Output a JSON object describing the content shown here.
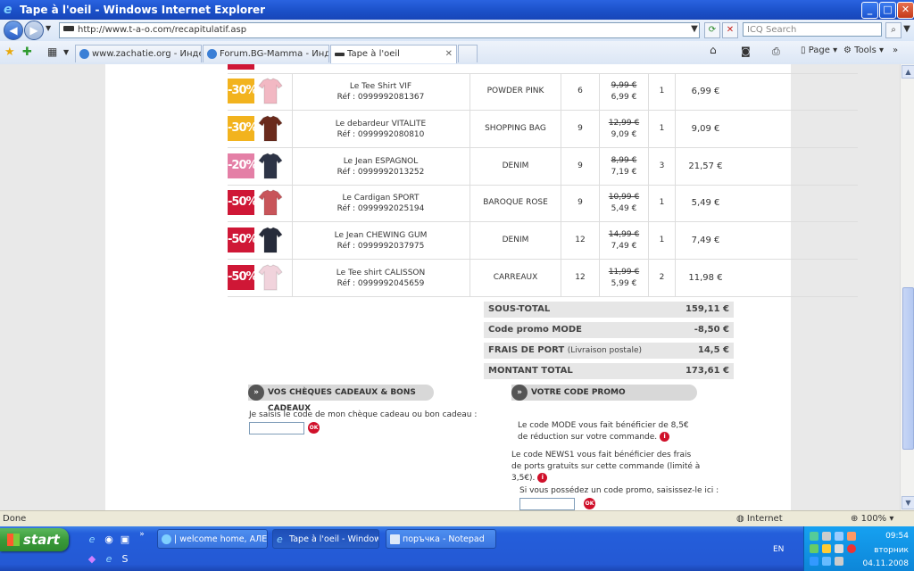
{
  "window": {
    "title": "Tape à l'oeil - Windows Internet Explorer",
    "min": "_",
    "max": "□",
    "close": "✕"
  },
  "address": {
    "url": "http://www.t-a-o.com/recapitulatif.asp",
    "search_placeholder": "ICQ Search"
  },
  "tabs": [
    {
      "label": "www.zachatie.org - Индекс"
    },
    {
      "label": "Forum.BG-Mamma - Индекс"
    },
    {
      "label": "Tape à l'oeil"
    }
  ],
  "commands": {
    "page": "Page",
    "tools": "Tools"
  },
  "items": [
    {
      "discount": "-30%",
      "badge_color": "#f2b31e",
      "img_color": "#f2b8c3",
      "name": "Le Tee Shirt VIF",
      "ref": "Réf : 0999992081367",
      "color": "POWDER PINK",
      "size": "6",
      "old_price": "9,99 €",
      "new_price": "6,99 €",
      "qty": "1",
      "total": "6,99 €"
    },
    {
      "discount": "-30%",
      "badge_color": "#f2b31e",
      "img_color": "#6a2a1c",
      "name": "Le debardeur VITALITE",
      "ref": "Réf : 0999992080810",
      "color": "SHOPPING BAG",
      "size": "9",
      "old_price": "12,99 €",
      "new_price": "9,09 €",
      "qty": "1",
      "total": "9,09 €"
    },
    {
      "discount": "-20%",
      "badge_color": "#e47fa6",
      "img_color": "#2d3446",
      "name": "Le Jean ESPAGNOL",
      "ref": "Réf : 0999992013252",
      "color": "DENIM",
      "size": "9",
      "old_price": "8,99 €",
      "new_price": "7,19 €",
      "qty": "3",
      "total": "21,57 €"
    },
    {
      "discount": "-50%",
      "badge_color": "#cf1736",
      "img_color": "#c8555a",
      "name": "Le Cardigan SPORT",
      "ref": "Réf : 0999992025194",
      "color": "BAROQUE ROSE",
      "size": "9",
      "old_price": "10,99 €",
      "new_price": "5,49 €",
      "qty": "1",
      "total": "5,49 €"
    },
    {
      "discount": "-50%",
      "badge_color": "#cf1736",
      "img_color": "#262b3a",
      "name": "Le Jean CHEWING GUM",
      "ref": "Réf : 0999992037975",
      "color": "DENIM",
      "size": "12",
      "old_price": "14,99 €",
      "new_price": "7,49 €",
      "qty": "1",
      "total": "7,49 €"
    },
    {
      "discount": "-50%",
      "badge_color": "#cf1736",
      "img_color": "#f1d3dc",
      "name": "Le Tee shirt CALISSON",
      "ref": "Réf : 0999992045659",
      "color": "CARREAUX",
      "size": "12",
      "old_price": "11,99 €",
      "new_price": "5,99 €",
      "qty": "2",
      "total": "11,98 €"
    }
  ],
  "summary": {
    "subtotal_label": "SOUS-TOTAL",
    "subtotal_value": "159,11 €",
    "promo_label": "Code promo MODE",
    "promo_value": "-8,50 €",
    "shipping_label": "FRAIS DE PORT",
    "shipping_note": "(Livraison postale)",
    "shipping_value": "14,5 €",
    "total_label": "MONTANT TOTAL",
    "total_value": "173,61 €"
  },
  "gift": {
    "header": "VOS CHÈQUES CADEAUX & BONS CADEAUX",
    "label": "Je saisis le code de mon chèque cadeau ou bon cadeau :",
    "ok": "OK"
  },
  "promo": {
    "header": "VOTRE CODE PROMO",
    "mode_text": "Le code MODE vous fait bénéficier de 8,5€ de réduction sur votre commande.",
    "news_text": "Le code NEWS1 vous fait bénéficier des frais de ports gratuits sur cette commande (limité à 3,5€).",
    "enter_label": "Si vous possédez un code promo, saisissez-le ici :",
    "ok": "OK"
  },
  "status": {
    "text": "Done",
    "zone": "Internet",
    "zoom": "100%"
  },
  "taskbar": {
    "start": "start",
    "buttons": [
      {
        "label": "| welcome home, АЛЕ..."
      },
      {
        "label": "Tape à l'oeil - Window..."
      },
      {
        "label": "поръчка - Notepad"
      }
    ],
    "lang": "EN",
    "time": "09:54",
    "day": "вторник",
    "date": "04.11.2008"
  }
}
